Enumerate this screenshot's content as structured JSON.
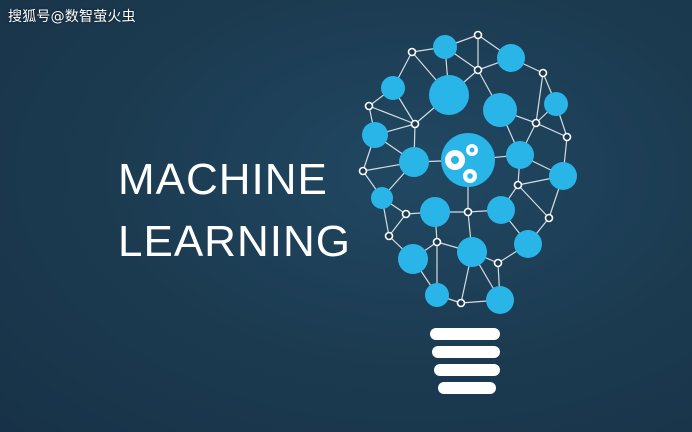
{
  "watermark": "搜狐号@数智萤火虫",
  "headline": {
    "line1": "MACHINE",
    "line2": "LEARNING"
  },
  "colors": {
    "background": "#1b3a50",
    "node": "#29b5e8",
    "text": "#ffffff"
  },
  "icons": {
    "center": "gears-icon",
    "base": "bulb-base-icon"
  }
}
